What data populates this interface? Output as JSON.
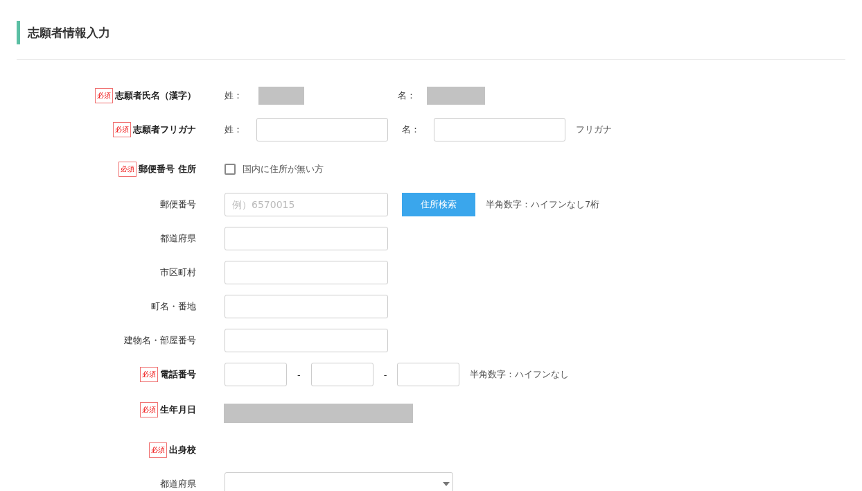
{
  "title": "志願者情報入力",
  "rows": [
    {
      "kind": "redacted-pair",
      "badge": "必須",
      "label": "志願者氏名（漢字）",
      "parts": [
        {
          "prefix": "姓："
        },
        {
          "prefix": "名："
        }
      ]
    },
    {
      "kind": "pair",
      "badge": "必須",
      "label": "志願者フリガナ",
      "parts": [
        {
          "prefix": "姓："
        },
        {
          "prefix": "名："
        }
      ],
      "note": "フリガナ"
    },
    {
      "kind": "checkbox",
      "badge": "必須",
      "label": "郵便番号 住所",
      "checkbox": {
        "label": "国内に住所が無い方",
        "checked": false
      }
    },
    {
      "kind": "input",
      "label": "郵便番号",
      "placeholder": "例）6570015",
      "button": "住所検索",
      "note": "半角数字：ハイフンなし7桁"
    },
    {
      "kind": "input",
      "label": "都道府県"
    },
    {
      "kind": "input",
      "label": "市区町村"
    },
    {
      "kind": "input",
      "label": "町名・番地"
    },
    {
      "kind": "input",
      "label": "建物名・部屋番号"
    },
    {
      "kind": "phone",
      "badge": "必須",
      "label": "電話番号",
      "separators": [
        "-",
        "-"
      ],
      "note": "半角数字：ハイフンなし"
    },
    {
      "kind": "redacted",
      "badge": "必須",
      "label": "生年月日"
    },
    {
      "kind": "heading",
      "badge": "必須",
      "label": "出身校"
    },
    {
      "kind": "select",
      "label": "都道府県"
    }
  ]
}
